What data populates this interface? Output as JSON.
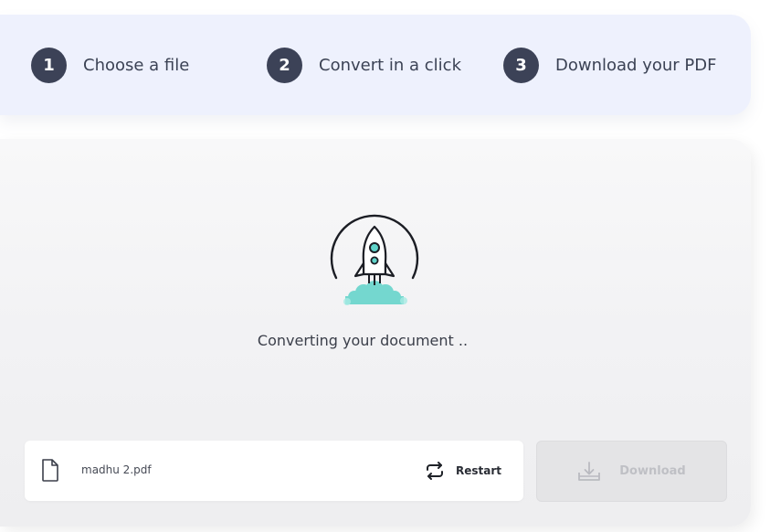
{
  "steps": [
    {
      "number": "1",
      "label": "Choose a file"
    },
    {
      "number": "2",
      "label": "Convert in a click"
    },
    {
      "number": "3",
      "label": "Download your PDF"
    }
  ],
  "conversion": {
    "illustration": "rocket-icon",
    "status_text": "Converting your document  .."
  },
  "file": {
    "icon": "document-icon",
    "name": "madhu 2.pdf",
    "restart_label": "Restart",
    "restart_icon": "refresh-arrows-icon"
  },
  "download": {
    "label": "Download",
    "icon": "download-tray-icon",
    "state": "disabled"
  },
  "colors": {
    "step_badge": "#3c4257",
    "steps_background": "#eef1fd",
    "rocket_flame": "#5fd3c9",
    "disabled_button": "#e4e4e6"
  }
}
